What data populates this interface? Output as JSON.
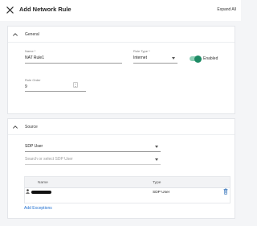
{
  "header": {
    "title": "Add Network Rule",
    "expand_all": "Expand All",
    "close_icon": "close-icon"
  },
  "general": {
    "section_title": "General",
    "name_label": "Name",
    "name_required": "*",
    "name_value": "NAT Rule1",
    "rule_type_label": "Rule Type",
    "rule_type_required": "*",
    "rule_type_value": "Internet",
    "enabled_label": "Enabled",
    "enabled": true,
    "rule_order_label": "Rule Order",
    "rule_order_value": "9",
    "accent_color": "#1d8a64"
  },
  "source": {
    "section_title": "Source",
    "source_type_value": "SDP User",
    "search_placeholder": "Search or select SDP User",
    "table": {
      "columns": [
        "Name",
        "Type"
      ],
      "rows": [
        {
          "name": "",
          "type": "SDP User"
        }
      ]
    },
    "add_exceptions": "Add Exceptions",
    "link_color": "#1f6fd1"
  }
}
